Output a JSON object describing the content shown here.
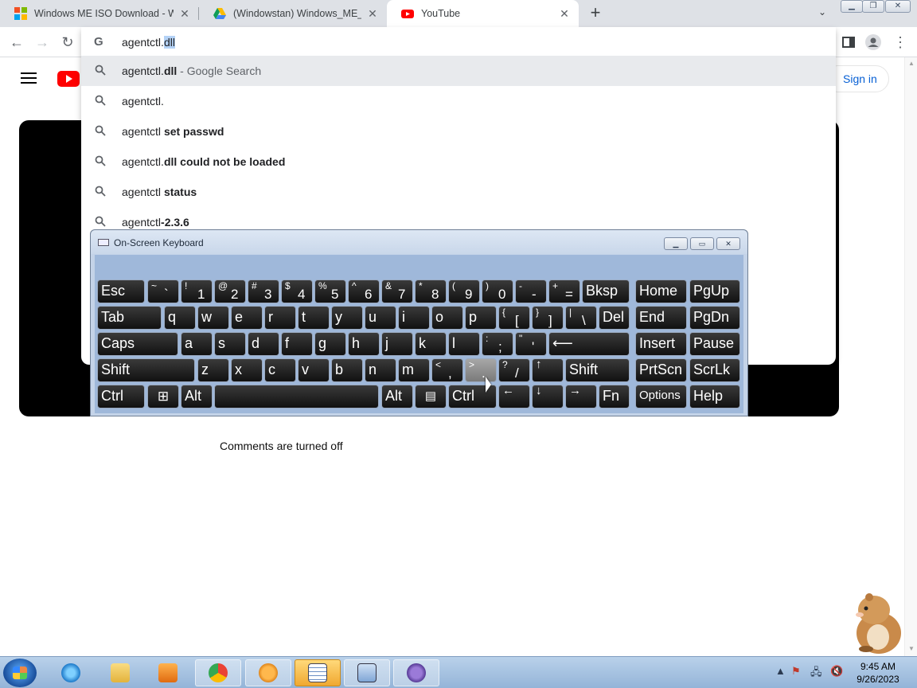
{
  "tabs": [
    {
      "title": "Windows ME ISO Download - W",
      "icon": "windows-logo-icon"
    },
    {
      "title": "(Windowstan) Windows_ME_Boo",
      "icon": "google-drive-icon"
    },
    {
      "title": "YouTube",
      "icon": "youtube-icon"
    }
  ],
  "omnibox": {
    "typed": "agentctl.",
    "autocomplete": "dll",
    "suggestions": [
      {
        "prefix": "agentctl.",
        "bold": "dll",
        "suffix": " - Google Search"
      },
      {
        "prefix": "agentctl.",
        "bold": "",
        "suffix": ""
      },
      {
        "prefix": "agentctl ",
        "bold": "set passwd",
        "suffix": ""
      },
      {
        "prefix": "agentctl.",
        "bold": "dll could not be loaded",
        "suffix": ""
      },
      {
        "prefix": "agentctl ",
        "bold": "status",
        "suffix": ""
      },
      {
        "prefix": "agentctl",
        "bold": "-2.3.6",
        "suffix": ""
      }
    ]
  },
  "youtube": {
    "sign_in": "Sign in",
    "comments_off": "Comments are turned off"
  },
  "osk": {
    "title": "On-Screen Keyboard",
    "keys": {
      "esc": "Esc",
      "tilde_s": "~",
      "tilde_b": "`",
      "n1_s": "!",
      "n1_b": "1",
      "n2_s": "@",
      "n2_b": "2",
      "n3_s": "#",
      "n3_b": "3",
      "n4_s": "$",
      "n4_b": "4",
      "n5_s": "%",
      "n5_b": "5",
      "n6_s": "^",
      "n6_b": "6",
      "n7_s": "&",
      "n7_b": "7",
      "n8_s": "*",
      "n8_b": "8",
      "n9_s": "(",
      "n9_b": "9",
      "n0_s": ")",
      "n0_b": "0",
      "minus_s": "-",
      "minus_b": "-",
      "plus_s": "+",
      "plus_b": "=",
      "bksp": "Bksp",
      "home": "Home",
      "pgup": "PgUp",
      "tab": "Tab",
      "q": "q",
      "w": "w",
      "e": "e",
      "r": "r",
      "t": "t",
      "y": "y",
      "u": "u",
      "i": "i",
      "o": "o",
      "p": "p",
      "lbr_s": "{",
      "lbr_b": "[",
      "rbr_s": "}",
      "rbr_b": "]",
      "bsl_s": "|",
      "bsl_b": "\\",
      "del": "Del",
      "end": "End",
      "pgdn": "PgDn",
      "caps": "Caps",
      "a": "a",
      "s": "s",
      "d": "d",
      "f": "f",
      "g": "g",
      "h": "h",
      "j": "j",
      "k": "k",
      "l": "l",
      "semi_s": ":",
      "semi_b": ";",
      "quote_s": "\"",
      "quote_b": "'",
      "enter": "⟵",
      "insert": "Insert",
      "pause": "Pause",
      "shift": "Shift",
      "z": "z",
      "x": "x",
      "c": "c",
      "v": "v",
      "b": "b",
      "n": "n",
      "m": "m",
      "comma_s": "<",
      "comma_b": ",",
      "period_s": ">",
      "period_b": ".",
      "slash_s": "?",
      "slash_b": "/",
      "up": "↑",
      "shift_r": "Shift",
      "prtscn": "PrtScn",
      "scrlk": "ScrLk",
      "ctrl": "Ctrl",
      "win": "⊞",
      "alt": "Alt",
      "alt_r": "Alt",
      "menu": "▤",
      "ctrl_r": "Ctrl",
      "left": "←",
      "down": "↓",
      "right": "→",
      "fn": "Fn",
      "options": "Options",
      "help": "Help"
    }
  },
  "taskbar": {
    "time": "9:45 AM",
    "date": "9/26/2023"
  }
}
